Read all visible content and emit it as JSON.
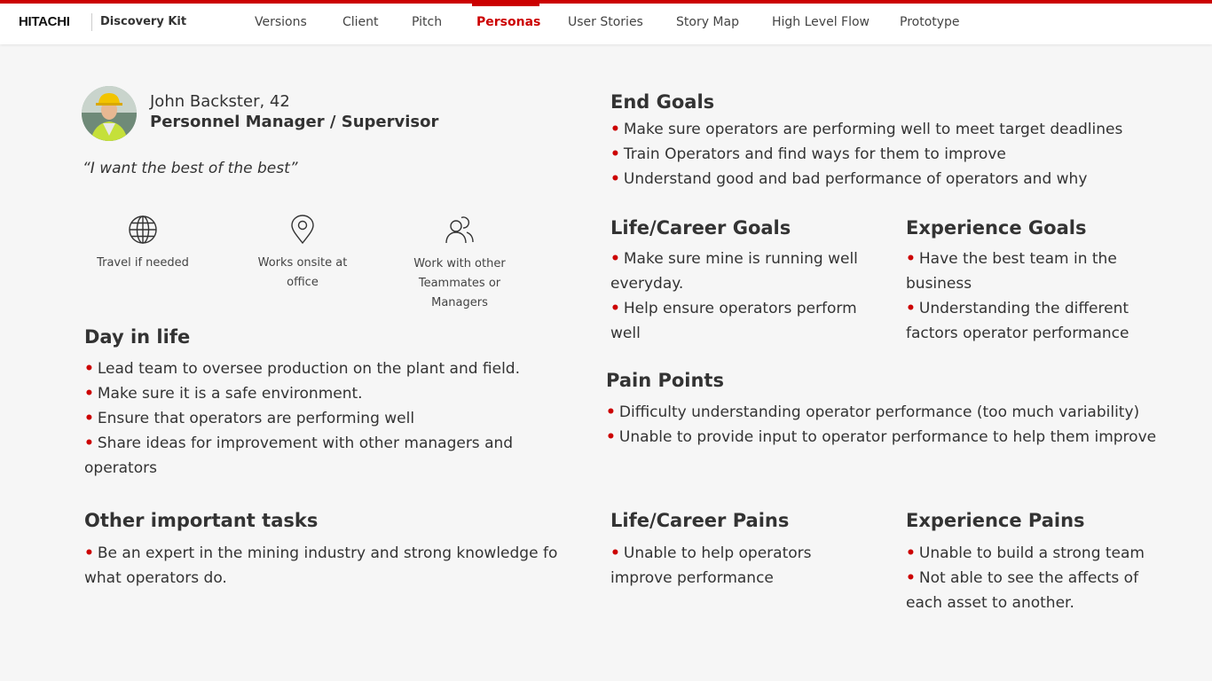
{
  "header": {
    "logo": "HITACHI",
    "product": "Discovery Kit",
    "nav": [
      "Versions",
      "Client",
      "Pitch",
      "Personas",
      "User Stories",
      "Story Map",
      "High Level Flow",
      "Prototype"
    ],
    "active_nav": "Personas",
    "accent_color": "#cc0000"
  },
  "persona": {
    "name": "John Backster, 42",
    "role": "Personnel Manager / Supervisor",
    "quote": "“I want the best of the best”",
    "attributes": [
      {
        "icon": "globe-icon",
        "label": "Travel if needed"
      },
      {
        "icon": "location-pin-icon",
        "label": "Works onsite at office"
      },
      {
        "icon": "people-icon",
        "label": "Work with other Teammates or Managers"
      }
    ]
  },
  "day_in_life": {
    "title": "Day in life",
    "items": [
      "Lead team to oversee production on the plant and field.",
      "Make sure it is a safe environment.",
      "Ensure that operators are performing well",
      "Share ideas for improvement with other managers and operators"
    ]
  },
  "other_tasks": {
    "title": "Other important tasks",
    "items": [
      "Be an expert in the mining industry and strong knowledge fo what operators do."
    ]
  },
  "end_goals": {
    "title": "End Goals",
    "items": [
      "Make sure operators are performing well to meet target deadlines",
      "Train Operators and find ways for them to improve",
      "Understand good and bad performance of operators and why"
    ]
  },
  "life_goals": {
    "title": "Life/Career Goals",
    "items": [
      "Make sure mine is running well everyday.",
      "Help ensure operators perform well"
    ]
  },
  "experience_goals": {
    "title": "Experience Goals",
    "items": [
      "Have the best team in the business",
      "Understanding the different factors operator performance"
    ]
  },
  "pain_points": {
    "title": "Pain Points",
    "items": [
      "Difficulty understanding operator performance (too much variability)",
      "Unable to provide input to operator performance to help them improve"
    ]
  },
  "life_pains": {
    "title": "Life/Career Pains",
    "items": [
      "Unable to help operators improve performance"
    ]
  },
  "experience_pains": {
    "title": "Experience Pains",
    "items": [
      "Unable to build a strong team",
      "Not able to see the affects of each asset to another."
    ]
  }
}
